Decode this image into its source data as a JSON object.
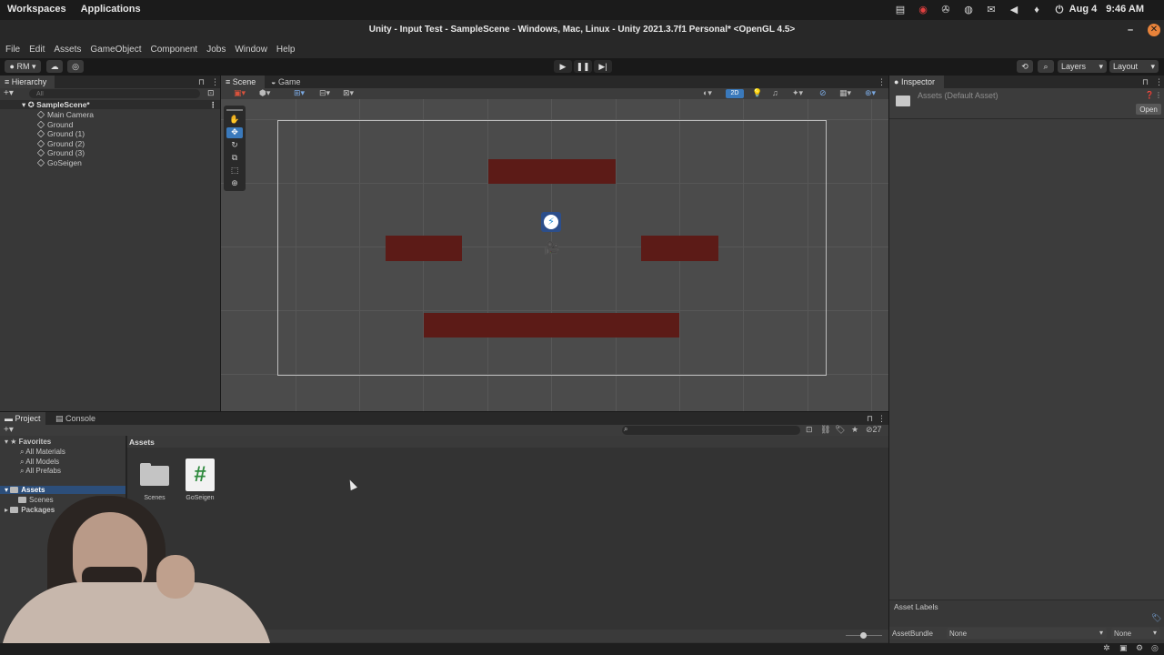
{
  "os_bar": {
    "workspaces": "Workspaces",
    "applications": "Applications",
    "date": "Aug 4",
    "time": "9:46 AM"
  },
  "window": {
    "title": "Unity - Input Test - SampleScene - Windows, Mac, Linux - Unity 2021.3.7f1 Personal* <OpenGL 4.5>"
  },
  "menu": [
    "File",
    "Edit",
    "Assets",
    "GameObject",
    "Component",
    "Jobs",
    "Window",
    "Help"
  ],
  "toolbar": {
    "account": "RM",
    "layers_label": "Layers",
    "layout_label": "Layout"
  },
  "hierarchy": {
    "tab_label": "Hierarchy",
    "search_placeholder": "All",
    "scene_name": "SampleScene*",
    "items": [
      "Main Camera",
      "Ground",
      "Ground (1)",
      "Ground (2)",
      "Ground (3)",
      "GoSeigen"
    ]
  },
  "scene_tabs": {
    "scene": "Scene",
    "game": "Game",
    "mode_2d": "2D"
  },
  "inspector": {
    "tab_label": "Inspector",
    "asset_title": "Assets (Default Asset)",
    "open_button": "Open",
    "asset_labels": "Asset Labels",
    "asset_bundle_label": "AssetBundle",
    "bundle_value_1": "None",
    "bundle_value_2": "None"
  },
  "project": {
    "tab_project": "Project",
    "tab_console": "Console",
    "hidden_count": "27",
    "favorites_label": "Favorites",
    "favorites": [
      "All Materials",
      "All Models",
      "All Prefabs"
    ],
    "assets_root": "Assets",
    "assets_children": [
      "Scenes"
    ],
    "packages": "Packages",
    "breadcrumb": "Assets",
    "grid_items": [
      {
        "name": "Scenes",
        "kind": "folder-icon"
      },
      {
        "name": "GoSeigen",
        "kind": "csharp-script-icon"
      }
    ]
  },
  "colors": {
    "accent": "#3a79bb",
    "ground_block": "#5c1b17",
    "scene_bg": "#4b4b4b",
    "panel_bg": "#383838",
    "script_green": "#2f8a3e"
  }
}
